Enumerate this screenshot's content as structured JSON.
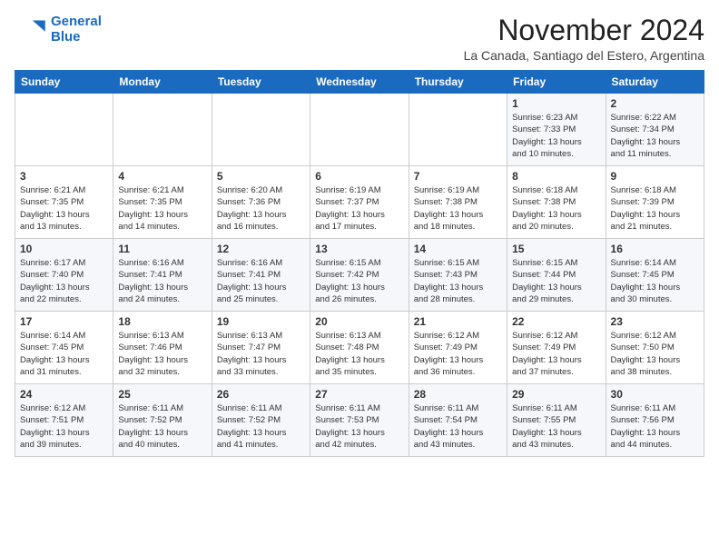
{
  "header": {
    "logo_line1": "General",
    "logo_line2": "Blue",
    "month": "November 2024",
    "location": "La Canada, Santiago del Estero, Argentina"
  },
  "weekdays": [
    "Sunday",
    "Monday",
    "Tuesday",
    "Wednesday",
    "Thursday",
    "Friday",
    "Saturday"
  ],
  "weeks": [
    [
      {
        "day": "",
        "info": ""
      },
      {
        "day": "",
        "info": ""
      },
      {
        "day": "",
        "info": ""
      },
      {
        "day": "",
        "info": ""
      },
      {
        "day": "",
        "info": ""
      },
      {
        "day": "1",
        "info": "Sunrise: 6:23 AM\nSunset: 7:33 PM\nDaylight: 13 hours\nand 10 minutes."
      },
      {
        "day": "2",
        "info": "Sunrise: 6:22 AM\nSunset: 7:34 PM\nDaylight: 13 hours\nand 11 minutes."
      }
    ],
    [
      {
        "day": "3",
        "info": "Sunrise: 6:21 AM\nSunset: 7:35 PM\nDaylight: 13 hours\nand 13 minutes."
      },
      {
        "day": "4",
        "info": "Sunrise: 6:21 AM\nSunset: 7:35 PM\nDaylight: 13 hours\nand 14 minutes."
      },
      {
        "day": "5",
        "info": "Sunrise: 6:20 AM\nSunset: 7:36 PM\nDaylight: 13 hours\nand 16 minutes."
      },
      {
        "day": "6",
        "info": "Sunrise: 6:19 AM\nSunset: 7:37 PM\nDaylight: 13 hours\nand 17 minutes."
      },
      {
        "day": "7",
        "info": "Sunrise: 6:19 AM\nSunset: 7:38 PM\nDaylight: 13 hours\nand 18 minutes."
      },
      {
        "day": "8",
        "info": "Sunrise: 6:18 AM\nSunset: 7:38 PM\nDaylight: 13 hours\nand 20 minutes."
      },
      {
        "day": "9",
        "info": "Sunrise: 6:18 AM\nSunset: 7:39 PM\nDaylight: 13 hours\nand 21 minutes."
      }
    ],
    [
      {
        "day": "10",
        "info": "Sunrise: 6:17 AM\nSunset: 7:40 PM\nDaylight: 13 hours\nand 22 minutes."
      },
      {
        "day": "11",
        "info": "Sunrise: 6:16 AM\nSunset: 7:41 PM\nDaylight: 13 hours\nand 24 minutes."
      },
      {
        "day": "12",
        "info": "Sunrise: 6:16 AM\nSunset: 7:41 PM\nDaylight: 13 hours\nand 25 minutes."
      },
      {
        "day": "13",
        "info": "Sunrise: 6:15 AM\nSunset: 7:42 PM\nDaylight: 13 hours\nand 26 minutes."
      },
      {
        "day": "14",
        "info": "Sunrise: 6:15 AM\nSunset: 7:43 PM\nDaylight: 13 hours\nand 28 minutes."
      },
      {
        "day": "15",
        "info": "Sunrise: 6:15 AM\nSunset: 7:44 PM\nDaylight: 13 hours\nand 29 minutes."
      },
      {
        "day": "16",
        "info": "Sunrise: 6:14 AM\nSunset: 7:45 PM\nDaylight: 13 hours\nand 30 minutes."
      }
    ],
    [
      {
        "day": "17",
        "info": "Sunrise: 6:14 AM\nSunset: 7:45 PM\nDaylight: 13 hours\nand 31 minutes."
      },
      {
        "day": "18",
        "info": "Sunrise: 6:13 AM\nSunset: 7:46 PM\nDaylight: 13 hours\nand 32 minutes."
      },
      {
        "day": "19",
        "info": "Sunrise: 6:13 AM\nSunset: 7:47 PM\nDaylight: 13 hours\nand 33 minutes."
      },
      {
        "day": "20",
        "info": "Sunrise: 6:13 AM\nSunset: 7:48 PM\nDaylight: 13 hours\nand 35 minutes."
      },
      {
        "day": "21",
        "info": "Sunrise: 6:12 AM\nSunset: 7:49 PM\nDaylight: 13 hours\nand 36 minutes."
      },
      {
        "day": "22",
        "info": "Sunrise: 6:12 AM\nSunset: 7:49 PM\nDaylight: 13 hours\nand 37 minutes."
      },
      {
        "day": "23",
        "info": "Sunrise: 6:12 AM\nSunset: 7:50 PM\nDaylight: 13 hours\nand 38 minutes."
      }
    ],
    [
      {
        "day": "24",
        "info": "Sunrise: 6:12 AM\nSunset: 7:51 PM\nDaylight: 13 hours\nand 39 minutes."
      },
      {
        "day": "25",
        "info": "Sunrise: 6:11 AM\nSunset: 7:52 PM\nDaylight: 13 hours\nand 40 minutes."
      },
      {
        "day": "26",
        "info": "Sunrise: 6:11 AM\nSunset: 7:52 PM\nDaylight: 13 hours\nand 41 minutes."
      },
      {
        "day": "27",
        "info": "Sunrise: 6:11 AM\nSunset: 7:53 PM\nDaylight: 13 hours\nand 42 minutes."
      },
      {
        "day": "28",
        "info": "Sunrise: 6:11 AM\nSunset: 7:54 PM\nDaylight: 13 hours\nand 43 minutes."
      },
      {
        "day": "29",
        "info": "Sunrise: 6:11 AM\nSunset: 7:55 PM\nDaylight: 13 hours\nand 43 minutes."
      },
      {
        "day": "30",
        "info": "Sunrise: 6:11 AM\nSunset: 7:56 PM\nDaylight: 13 hours\nand 44 minutes."
      }
    ]
  ]
}
